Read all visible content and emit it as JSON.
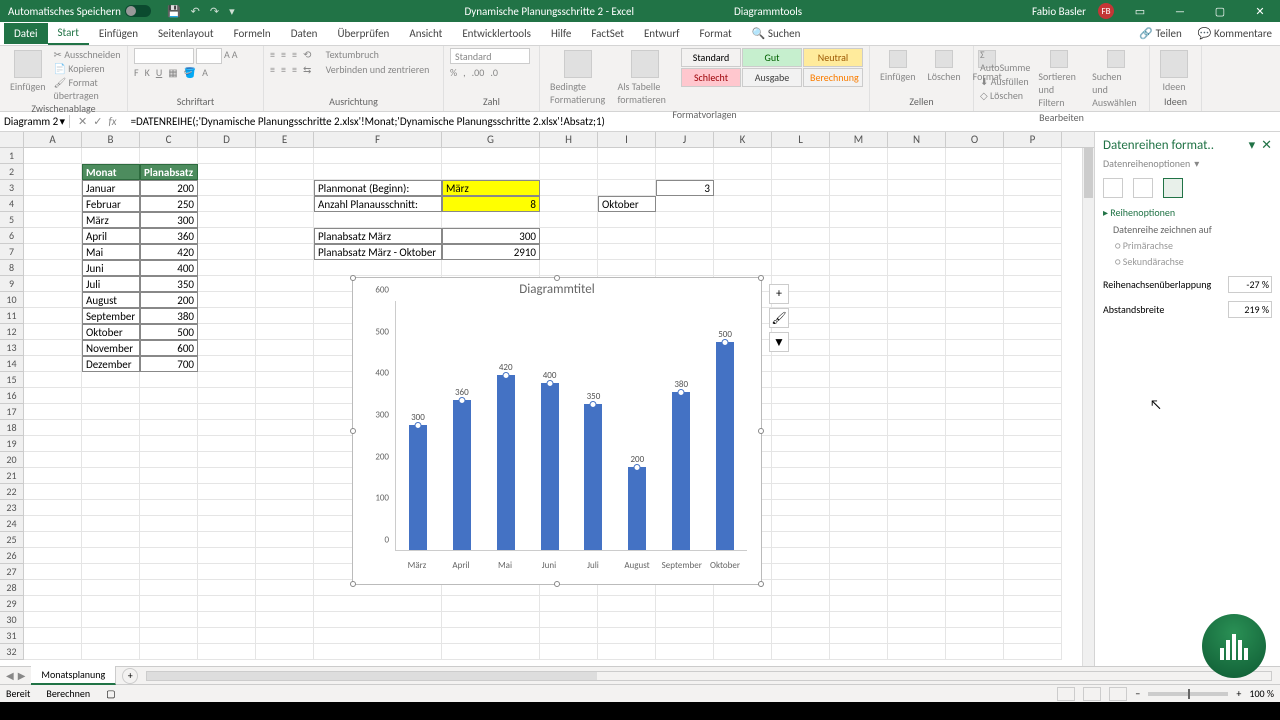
{
  "titlebar": {
    "autosave": "Automatisches Speichern",
    "doc_title": "Dynamische Planungsschritte 2 - Excel",
    "context_tab": "Diagrammtools",
    "user": "Fabio Basler",
    "user_initials": "FB"
  },
  "tabs": [
    "Datei",
    "Start",
    "Einfügen",
    "Seitenlayout",
    "Formeln",
    "Daten",
    "Überprüfen",
    "Ansicht",
    "Entwicklertools",
    "Hilfe",
    "FactSet",
    "Entwurf",
    "Format",
    "Suchen"
  ],
  "tabs_right": {
    "share": "Teilen",
    "comments": "Kommentare"
  },
  "ribbon": {
    "clipboard": {
      "label": "Zwischenablage",
      "paste": "Einfügen",
      "cut": "Ausschneiden",
      "copy": "Kopieren",
      "format": "Format übertragen"
    },
    "font": {
      "label": "Schriftart"
    },
    "align": {
      "label": "Ausrichtung",
      "wrap": "Textumbruch",
      "merge": "Verbinden und zentrieren"
    },
    "number": {
      "label": "Zahl",
      "format": "Standard"
    },
    "styles": {
      "label": "Formatvorlagen",
      "cond": "Bedingte Formatierung",
      "astable": "Als Tabelle formatieren",
      "s1": "Standard",
      "s2": "Gut",
      "s3": "Neutral",
      "s4": "Schlecht",
      "s5": "Ausgabe",
      "s6": "Berechnung"
    },
    "cells": {
      "label": "Zellen",
      "ins": "Einfügen",
      "del": "Löschen",
      "fmt": "Format"
    },
    "editing": {
      "label": "Bearbeiten",
      "sum": "AutoSumme",
      "fill": "Ausfüllen",
      "clear": "Löschen",
      "sort": "Sortieren und Filtern",
      "find": "Suchen und Auswählen"
    },
    "ideas": {
      "label": "Ideen",
      "btn": "Ideen"
    }
  },
  "namebox": "Diagramm 2",
  "formula": "=DATENREIHE(;'Dynamische Planungsschritte 2.xlsx'!Monat;'Dynamische Planungsschritte 2.xlsx'!Absatz;1)",
  "columns": [
    "A",
    "B",
    "C",
    "D",
    "E",
    "F",
    "G",
    "H",
    "I",
    "J",
    "K",
    "L",
    "M",
    "N",
    "O",
    "P"
  ],
  "table_header": {
    "b": "Monat",
    "c": "Planabsatz"
  },
  "months": [
    {
      "m": "Januar",
      "v": "200"
    },
    {
      "m": "Februar",
      "v": "250"
    },
    {
      "m": "März",
      "v": "300"
    },
    {
      "m": "April",
      "v": "360"
    },
    {
      "m": "Mai",
      "v": "420"
    },
    {
      "m": "Juni",
      "v": "400"
    },
    {
      "m": "Juli",
      "v": "350"
    },
    {
      "m": "August",
      "v": "200"
    },
    {
      "m": "September",
      "v": "380"
    },
    {
      "m": "Oktober",
      "v": "500"
    },
    {
      "m": "November",
      "v": "600"
    },
    {
      "m": "Dezember",
      "v": "700"
    }
  ],
  "params": {
    "p1_label": "Planmonat (Beginn):",
    "p1_val": "März",
    "p2_label": "Anzahl Planausschnitt:",
    "p2_val": "8",
    "j3": "3",
    "i4": "Oktober",
    "p3_label": "Planabsatz März",
    "p3_val": "300",
    "p4_label": "Planabsatz März - Oktober",
    "p4_val": "2910"
  },
  "chart_data": {
    "type": "bar",
    "title": "Diagrammtitel",
    "categories": [
      "März",
      "April",
      "Mai",
      "Juni",
      "Juli",
      "August",
      "September",
      "Oktober"
    ],
    "values": [
      300,
      360,
      420,
      400,
      350,
      200,
      380,
      500
    ],
    "ylim": [
      0,
      600
    ],
    "yticks": [
      0,
      100,
      200,
      300,
      400,
      500,
      600
    ]
  },
  "panel": {
    "title": "Datenreihen format..",
    "sub": "Datenreihenoptionen",
    "sect": "Reihenoptionen",
    "draw": "Datenreihe zeichnen auf",
    "r1": "Primärachse",
    "r2": "Sekundärachse",
    "overlap_l": "Reihenachsenüberlappung",
    "overlap_v": "-27 %",
    "gap_l": "Abstandsbreite",
    "gap_v": "219 %"
  },
  "sheet_tab": "Monatsplanung",
  "status": {
    "ready": "Bereit",
    "calc": "Berechnen",
    "zoom": "100 %"
  }
}
